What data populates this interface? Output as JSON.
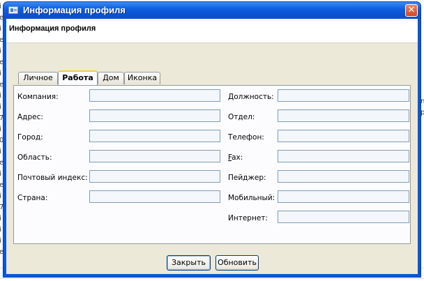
{
  "window": {
    "title": "Информация профиля",
    "close_glyph": "✕"
  },
  "header": {
    "title": "Информация профиля"
  },
  "tabs": [
    {
      "label": "Личное",
      "active": false
    },
    {
      "label": "Работа",
      "active": true
    },
    {
      "label": "Дом",
      "active": false
    },
    {
      "label": "Иконка",
      "active": false
    }
  ],
  "form": {
    "left": [
      {
        "label": "Компания:",
        "value": ""
      },
      {
        "label": "Адрес:",
        "value": ""
      },
      {
        "label": "Город:",
        "value": ""
      },
      {
        "label": "Область:",
        "value": ""
      },
      {
        "label": "Почтовый индекс:",
        "value": ""
      },
      {
        "label": "Страна:",
        "value": ""
      }
    ],
    "right": [
      {
        "label": "Должность:",
        "value": ""
      },
      {
        "label": "Отдел:",
        "value": ""
      },
      {
        "label": "Телефон:",
        "value": ""
      },
      {
        "label": "Fax:",
        "value": ""
      },
      {
        "label": "Пейджер:",
        "value": ""
      },
      {
        "label": "Мобильный:",
        "value": ""
      },
      {
        "label": "Интернет:",
        "value": ""
      }
    ]
  },
  "buttons": {
    "close_label": "Закрыть",
    "refresh_label": "Обновить"
  },
  "background": {
    "left_letters": [
      "i",
      "e",
      "i",
      "e",
      "i",
      "e",
      "i",
      "e",
      "i",
      "i",
      "7",
      "i",
      "0",
      "i",
      "e",
      "i",
      "e",
      "i",
      "7",
      "i",
      "i",
      "i",
      "e"
    ],
    "right_letters": [
      "n",
      "p"
    ]
  },
  "colors": {
    "titlebar": "#0a57d8",
    "client": "#ece9d8",
    "tab_highlight": "#ffc83c",
    "input_border": "#7f9db9"
  },
  "icons": {
    "window_icon": "profile-card-icon",
    "close": "close-icon"
  }
}
